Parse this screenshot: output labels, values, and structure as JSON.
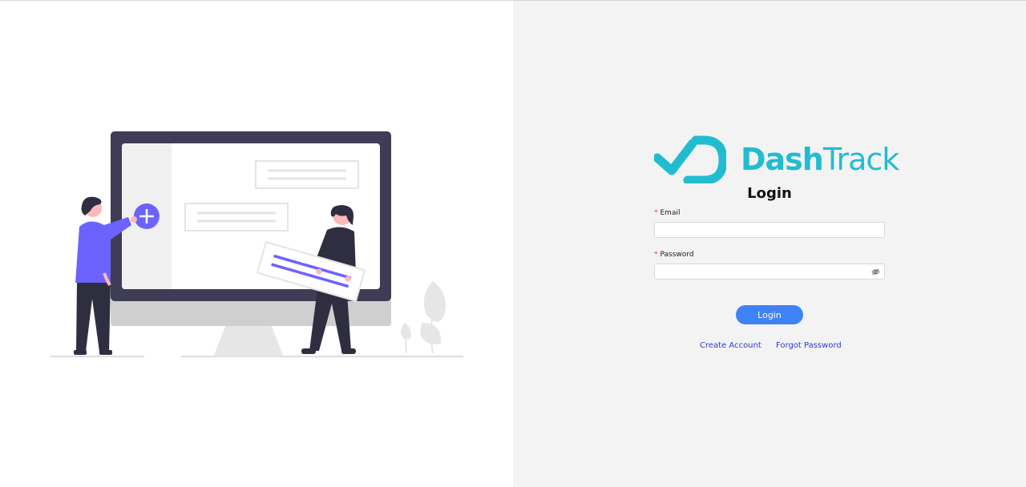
{
  "brand": {
    "logo_icon": "dashtrack-logo-icon",
    "name_bold": "Dash",
    "name_light": "Track",
    "color": "#22bcd0"
  },
  "login_form": {
    "title": "Login",
    "email": {
      "required_mark": "*",
      "label": "Email",
      "value": "",
      "placeholder": ""
    },
    "password": {
      "required_mark": "*",
      "label": "Password",
      "value": "",
      "placeholder": "",
      "toggle_icon": "eye-slash-icon"
    },
    "submit_label": "Login",
    "submit_color": "#3f82f7",
    "links": {
      "create_account": "Create Account",
      "forgot_password": "Forgot Password"
    },
    "link_color": "#2d3bd6"
  },
  "illustration": {
    "description_icon": "people-with-monitor-illustration",
    "accent_color": "#6c63ff"
  },
  "colors": {
    "left_background": "#ffffff",
    "right_background": "#f3f3f4"
  }
}
